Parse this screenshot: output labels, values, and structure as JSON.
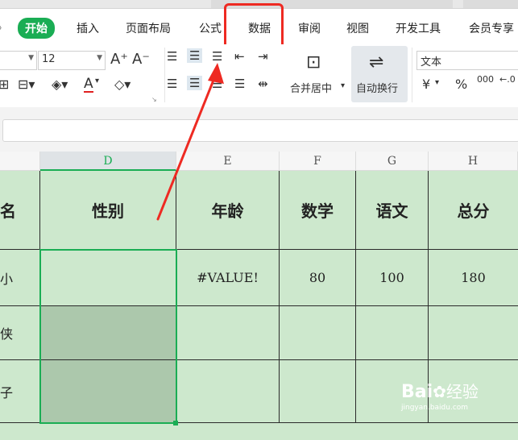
{
  "menu": {
    "items": [
      {
        "label": "开始",
        "active": true
      },
      {
        "label": "插入"
      },
      {
        "label": "页面布局"
      },
      {
        "label": "公式"
      },
      {
        "label": "数据"
      },
      {
        "label": "审阅"
      },
      {
        "label": "视图"
      },
      {
        "label": "开发工具"
      },
      {
        "label": "会员专享"
      }
    ]
  },
  "toolbar": {
    "font_size": "12",
    "merge_center_label": "合并居中",
    "wrap_text_label": "自动换行",
    "number_format": "文本",
    "currency_symbol": "¥",
    "percent_symbol": "%",
    "thousands_symbol": "000"
  },
  "columns": [
    "D",
    "E",
    "F",
    "G",
    "H"
  ],
  "table": {
    "headers": [
      "名",
      "性别",
      "年龄",
      "数学",
      "语文",
      "总分"
    ],
    "rows": [
      [
        "小",
        "",
        "#VALUE!",
        "80",
        "100",
        "180"
      ],
      [
        "侠",
        "",
        "",
        "",
        "",
        ""
      ],
      [
        "子",
        "",
        "",
        "",
        "",
        ""
      ]
    ]
  },
  "watermark": {
    "brand": "Bai",
    "brand2": "经验",
    "url": "jingyan.baidu.com"
  },
  "colors": {
    "accent": "#1aad54",
    "highlight": "#ee2a22",
    "sheet_bg": "#cde8cd",
    "selected_fill": "#acc8ac"
  }
}
